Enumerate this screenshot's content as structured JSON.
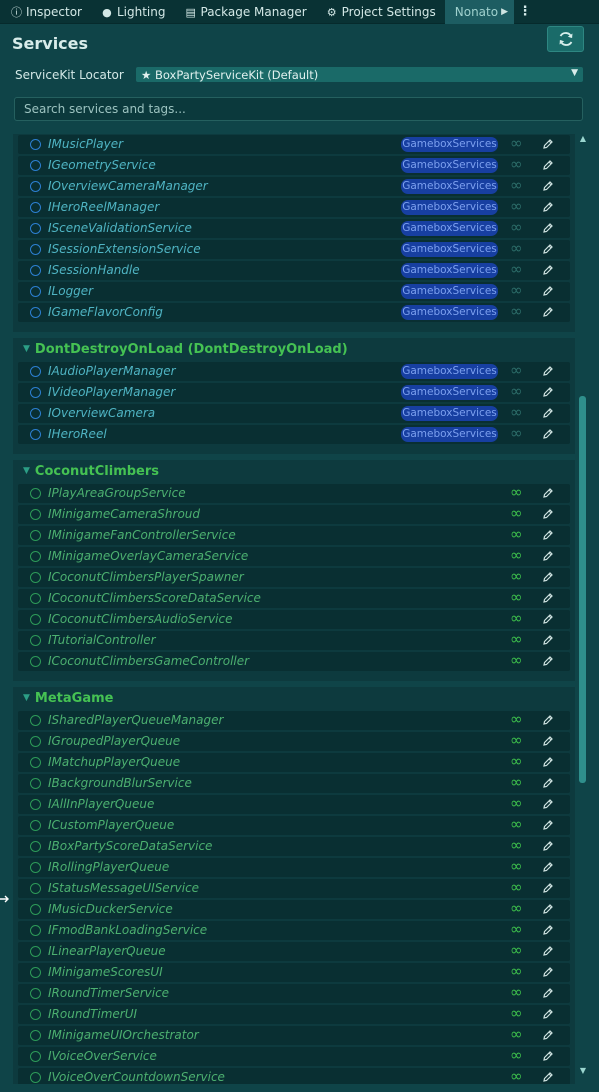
{
  "tabs": [
    {
      "label": "Inspector",
      "icon": "info-icon"
    },
    {
      "label": "Lighting",
      "icon": "bulb-icon"
    },
    {
      "label": "Package Manager",
      "icon": "package-icon"
    },
    {
      "label": "Project Settings",
      "icon": "gear-icon"
    },
    {
      "label": "Nonato",
      "icon": "",
      "active": true
    }
  ],
  "header": {
    "title": "Services",
    "locator_label": "ServiceKit Locator",
    "locator_value": "★ BoxPartyServiceKit (Default)"
  },
  "search": {
    "placeholder": "Search services and tags..."
  },
  "sections": [
    {
      "name": "",
      "collapsed_header_hidden": true,
      "tagged": true,
      "tag": "GameboxServices",
      "items": [
        "IMusicPlayer",
        "IGeometryService",
        "IOverviewCameraManager",
        "IHeroReelManager",
        "ISceneValidationService",
        "ISessionExtensionService",
        "ISessionHandle",
        "ILogger",
        "IGameFlavorConfig"
      ]
    },
    {
      "name": "DontDestroyOnLoad (DontDestroyOnLoad)",
      "tagged": true,
      "tag": "GameboxServices",
      "items": [
        "IAudioPlayerManager",
        "IVideoPlayerManager",
        "IOverviewCamera",
        "IHeroReel"
      ]
    },
    {
      "name": "CoconutClimbers",
      "tagged": false,
      "items": [
        "IPlayAreaGroupService",
        "IMinigameCameraShroud",
        "IMinigameFanControllerService",
        "IMinigameOverlayCameraService",
        "ICoconutClimbersPlayerSpawner",
        "ICoconutClimbersScoreDataService",
        "ICoconutClimbersAudioService",
        "ITutorialController",
        "ICoconutClimbersGameController"
      ]
    },
    {
      "name": "MetaGame",
      "tagged": false,
      "items": [
        "ISharedPlayerQueueManager",
        "IGroupedPlayerQueue",
        "IMatchupPlayerQueue",
        "IBackgroundBlurService",
        "IAllInPlayerQueue",
        "ICustomPlayerQueue",
        "IBoxPartyScoreDataService",
        "IRollingPlayerQueue",
        "IStatusMessageUIService",
        "IMusicDuckerService",
        "IFmodBankLoadingService",
        "ILinearPlayerQueue",
        "IMinigameScoresUI",
        "IRoundTimerService",
        "IRoundTimerUI",
        "IMinigameUIOrchestrator",
        "IVoiceOverService",
        "IVoiceOverCountdownService"
      ]
    }
  ],
  "icons": {
    "refresh": "refresh-icon",
    "infinity": "infinity-icon",
    "edit": "pencil-icon"
  },
  "colors": {
    "background": "#0f4448",
    "tag": "#173fa1",
    "section_title": "#45c253",
    "item_blue": "#4fb4c3",
    "item_green": "#4cb070"
  }
}
